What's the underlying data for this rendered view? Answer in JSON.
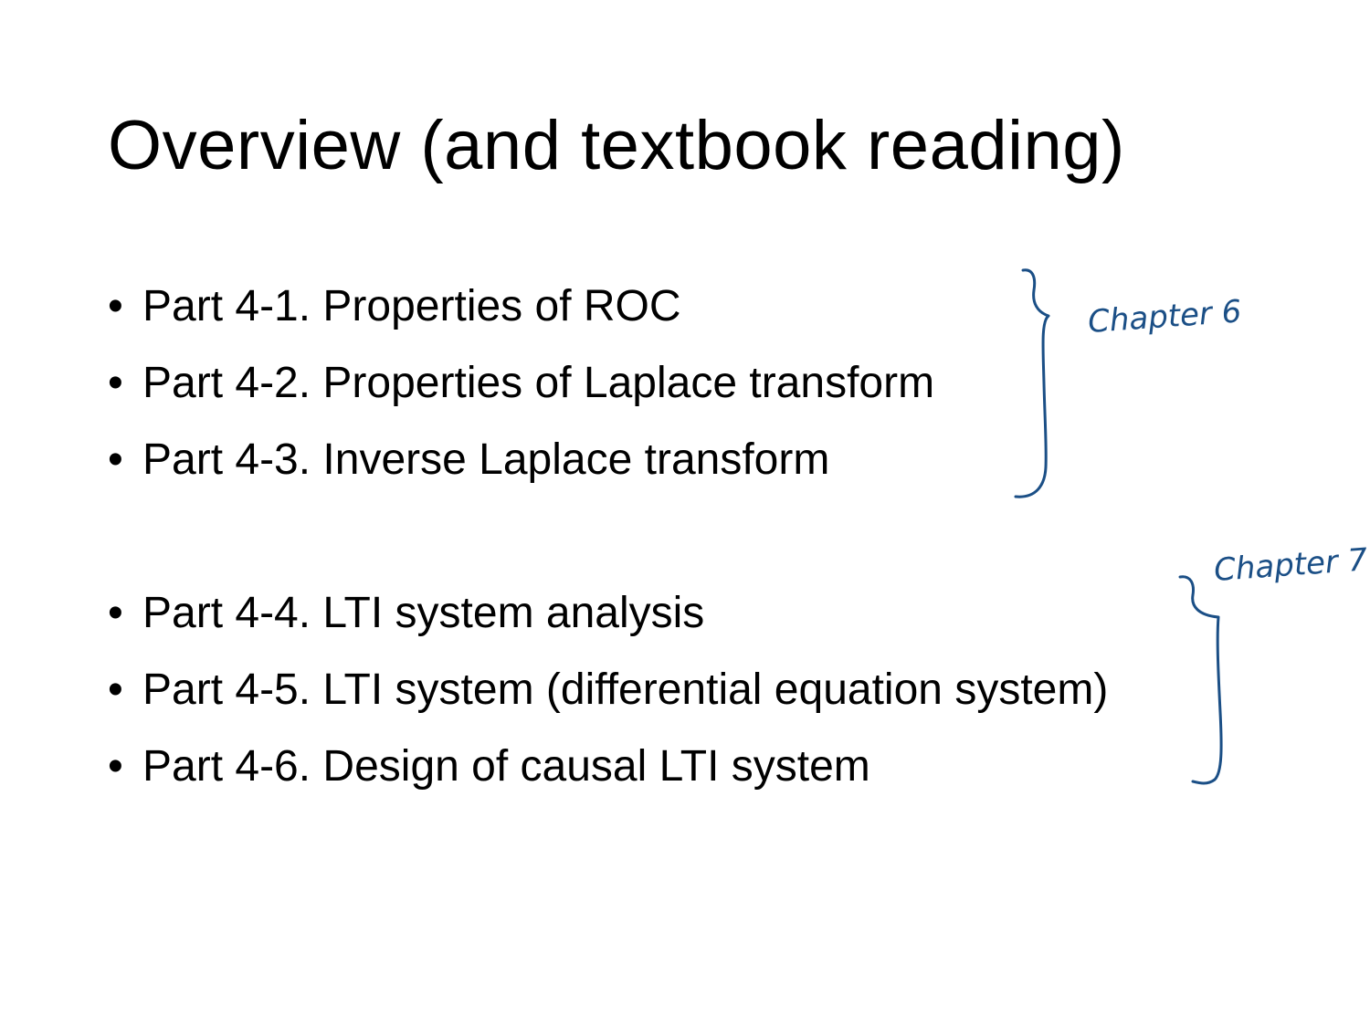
{
  "title": "Overview (and textbook reading)",
  "bullet_symbol": "•",
  "items": [
    {
      "text": "Part 4-1. Properties of ROC"
    },
    {
      "text": "Part 4-2. Properties of Laplace transform"
    },
    {
      "text": "Part 4-3. Inverse Laplace transform"
    },
    {
      "text": "Part 4-4. LTI system analysis"
    },
    {
      "text": "Part 4-5. LTI system (differential equation system)"
    },
    {
      "text": "Part 4-6. Design of causal LTI system"
    }
  ],
  "annotations": {
    "chapter_a": "Chapter 6",
    "chapter_b": "Chapter 7",
    "ink_color": "#1b4f86"
  }
}
